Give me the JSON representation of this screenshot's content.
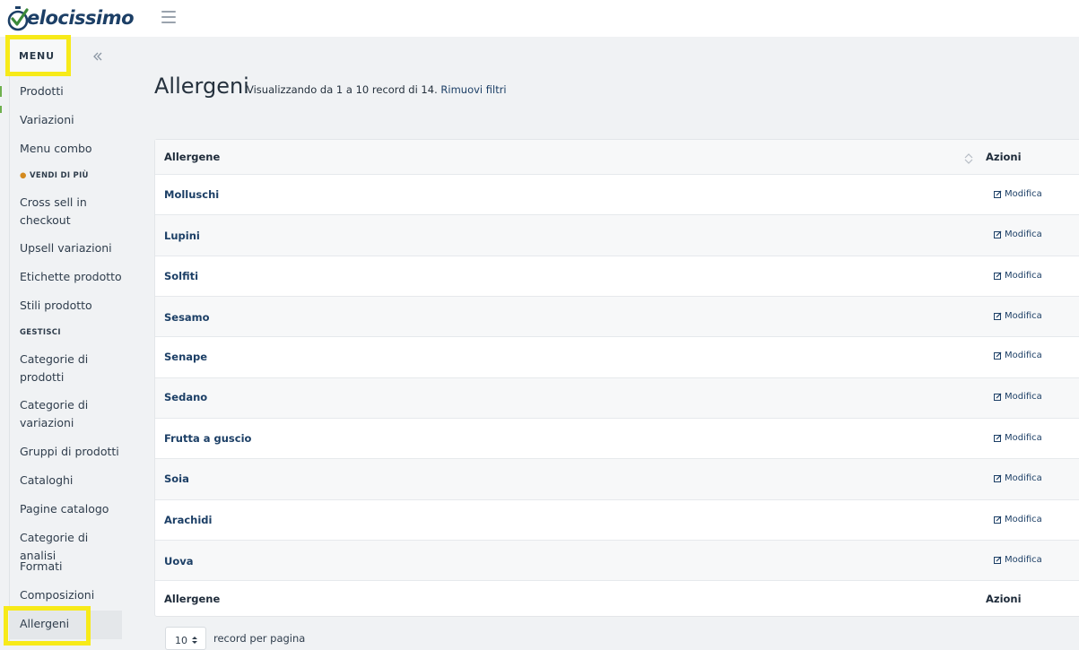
{
  "header": {
    "logo_text": "elocissimo",
    "brand_color": "#1c3f66"
  },
  "sidebar": {
    "menu_label": "MENU",
    "items": [
      {
        "label": "Prodotti"
      },
      {
        "label": "Variazioni"
      },
      {
        "label": "Menu combo"
      },
      {
        "label": "Cross sell in checkout"
      },
      {
        "label": "Upsell variazioni"
      },
      {
        "label": "Etichette prodotto"
      },
      {
        "label": "Stili prodotto"
      },
      {
        "label": "Categorie di prodotti"
      },
      {
        "label": "Categorie di variazioni"
      },
      {
        "label": "Gruppi di prodotti"
      },
      {
        "label": "Cataloghi"
      },
      {
        "label": "Pagine catalogo"
      },
      {
        "label": "Categorie di analisi"
      },
      {
        "label": "Formati"
      },
      {
        "label": "Composizioni"
      },
      {
        "label": "Allergeni"
      }
    ],
    "sections": {
      "sell_more": "VENDI DI PIÙ",
      "manage": "GESTISCI"
    },
    "highlight_color": "#f7ea19"
  },
  "main": {
    "title": "Allergeni",
    "subtitle": "Visualizzando da 1 a 10 record di 14.",
    "remove_filters": "Rimuovi filtri"
  },
  "table": {
    "header_name": "Allergene",
    "header_actions": "Azioni",
    "footer_name": "Allergene",
    "footer_actions": "Azioni",
    "edit_label": "Modifica",
    "rows": [
      {
        "name": "Molluschi"
      },
      {
        "name": "Lupini"
      },
      {
        "name": "Solfiti"
      },
      {
        "name": "Sesamo"
      },
      {
        "name": "Senape"
      },
      {
        "name": "Sedano"
      },
      {
        "name": "Frutta a guscio"
      },
      {
        "name": "Soia"
      },
      {
        "name": "Arachidi"
      },
      {
        "name": "Uova"
      }
    ]
  },
  "pagination": {
    "per_page_value": "10",
    "per_page_label": "record per pagina"
  }
}
